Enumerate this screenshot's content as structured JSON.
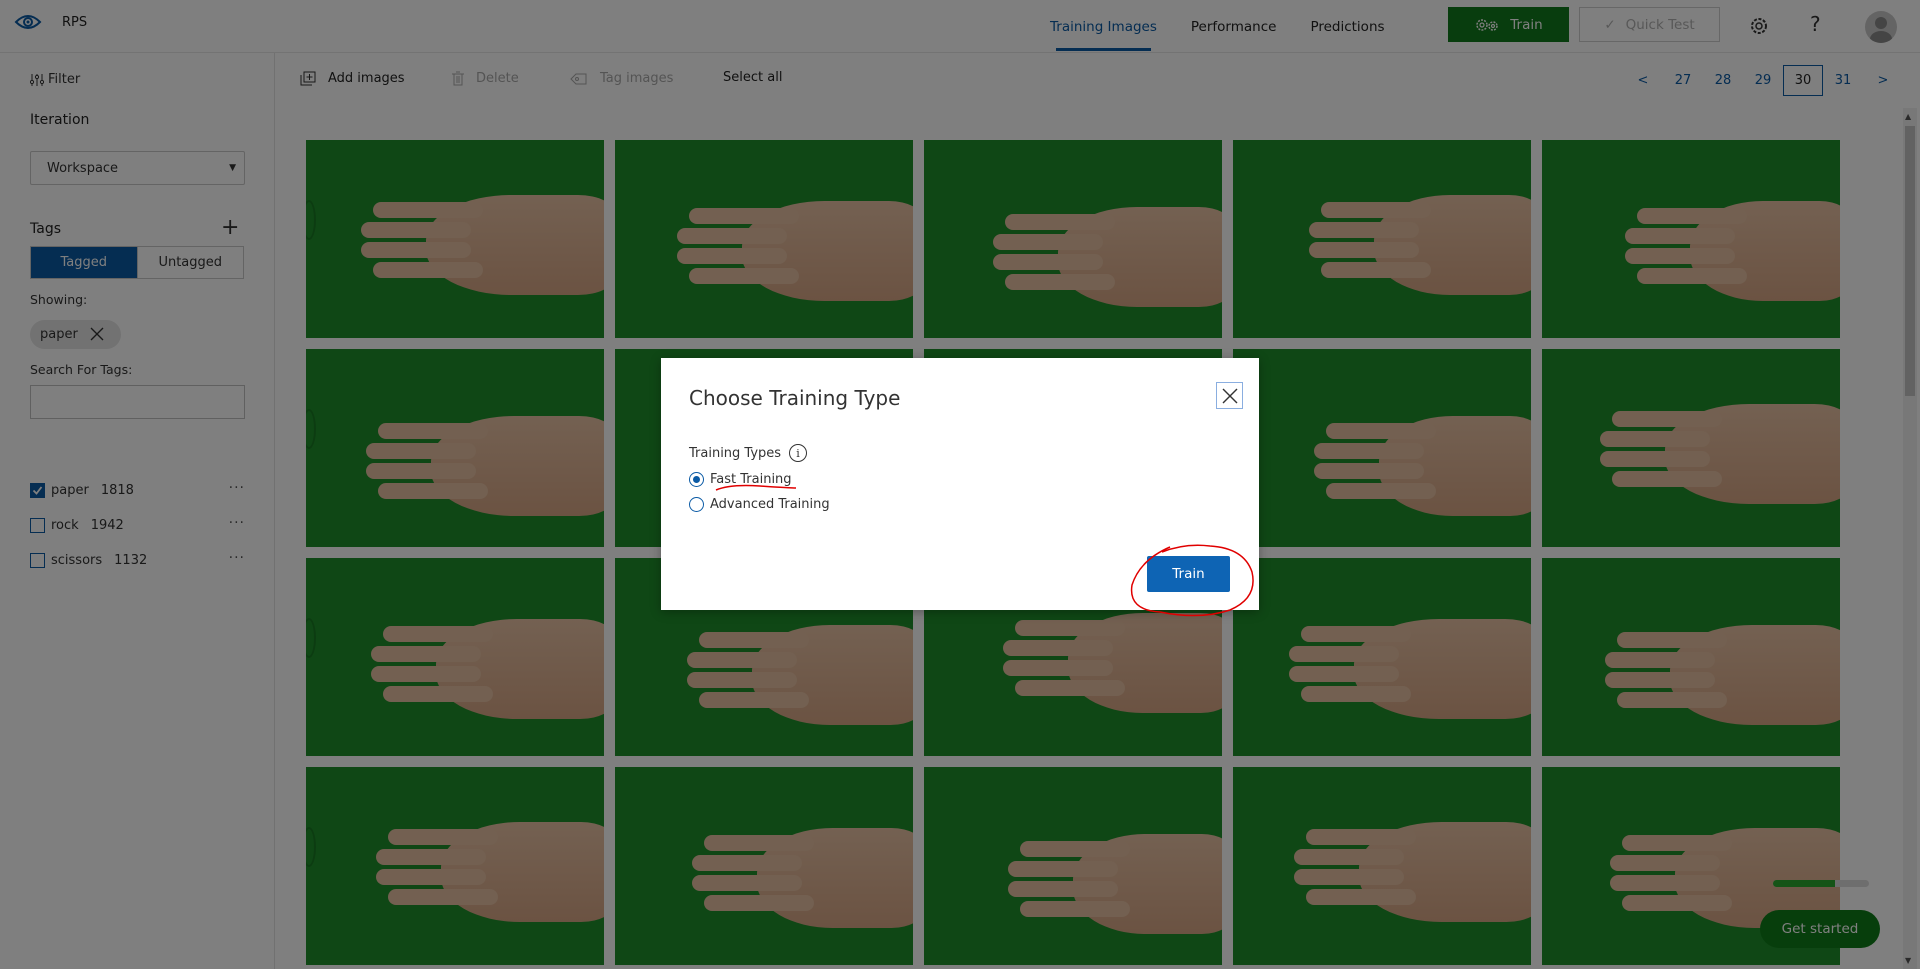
{
  "app": {
    "project_name": "RPS",
    "nav_tabs": [
      {
        "label": "Training Images",
        "active": true
      },
      {
        "label": "Performance",
        "active": false
      },
      {
        "label": "Predictions",
        "active": false
      }
    ],
    "train_button": "Train",
    "quick_test_button": "Quick Test",
    "help_glyph": "?",
    "icons": {
      "logo": "eye-gear-icon",
      "settings": "gear-icon",
      "help": "question-icon",
      "avatar": "user-avatar-icon"
    }
  },
  "colors": {
    "accent_blue": "#0a5aa5",
    "train_green": "#117a1c",
    "annotation_red": "#e00000",
    "image_bg_green": "#1e8f2a"
  },
  "sidebar": {
    "filter_label": "Filter",
    "iteration_label": "Iteration",
    "iteration_selected": "Workspace",
    "tags_label": "Tags",
    "add_tag_glyph": "+",
    "segment": {
      "tagged": "Tagged",
      "untagged": "Untagged",
      "selected": "Tagged"
    },
    "showing_label": "Showing:",
    "active_filter_chip": "paper",
    "search_label": "Search For Tags:",
    "search_value": "",
    "tags": [
      {
        "name": "paper",
        "count": "1818",
        "checked": true
      },
      {
        "name": "rock",
        "count": "1942",
        "checked": false
      },
      {
        "name": "scissors",
        "count": "1132",
        "checked": false
      }
    ],
    "more_glyph": "···"
  },
  "toolbar": {
    "add_images": "Add images",
    "delete": "Delete",
    "tag_images": "Tag images",
    "select_all": "Select all"
  },
  "pagination": {
    "prev": "<",
    "next": ">",
    "pages": [
      "27",
      "28",
      "29",
      "30",
      "31"
    ],
    "current": "30"
  },
  "grid": {
    "image_count": 20,
    "description": "paper hand gesture images on green background"
  },
  "onboarding": {
    "progress_fraction": 0.65,
    "get_started": "Get started"
  },
  "modal": {
    "title": "Choose Training Type",
    "types_label": "Training Types",
    "info_glyph": "i",
    "options": [
      {
        "label": "Fast Training",
        "selected": true
      },
      {
        "label": "Advanced Training",
        "selected": false
      }
    ],
    "train_button": "Train"
  }
}
